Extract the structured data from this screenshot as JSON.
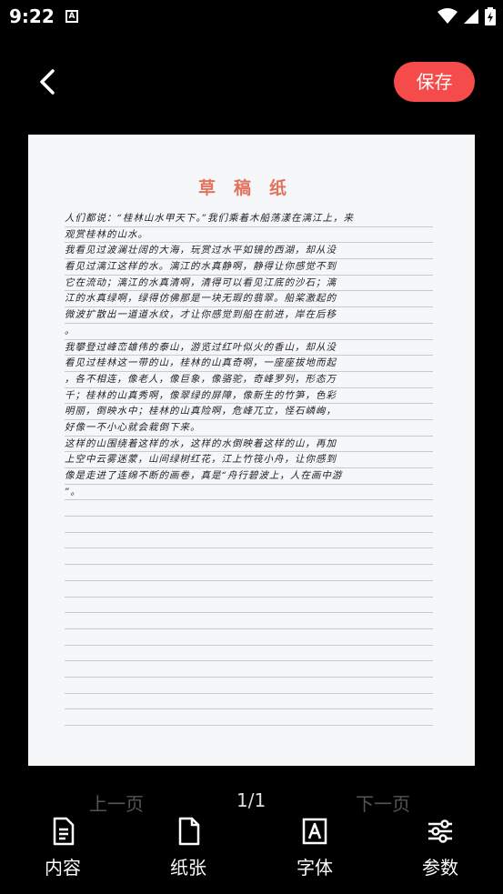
{
  "status": {
    "time": "9:22"
  },
  "toolbar": {
    "save_label": "保存"
  },
  "paper": {
    "title": "草稿纸",
    "lines": [
      "人们都说：“桂林山水甲天下。”我们乘着木船荡漾在漓江上，来",
      "观赏桂林的山水。",
      "我看见过波澜壮阔的大海，玩赏过水平如镜的西湖，却从没",
      "看见过漓江这样的水。漓江的水真静啊，静得让你感觉不到",
      "它在流动；漓江的水真清啊，清得可以看见江底的沙石；漓",
      "江的水真绿啊，绿得仿佛那是一块无瑕的翡翠。船桨激起的",
      "微波扩散出一道道水纹，才让你感觉到船在前进，岸在后移",
      "。",
      "我攀登过峰峦雄伟的泰山，游览过红叶似火的香山，却从没",
      "看见过桂林这一带的山，桂林的山真奇啊，一座座拔地而起",
      "，各不相连，像老人，像巨象，像骆驼，奇峰罗列，形态万",
      "千；桂林的山真秀啊，像翠绿的屏障，像新生的竹笋，色彩",
      "明丽，倒映水中；桂林的山真险啊，危峰兀立，怪石嶙峋，",
      "好像一不小心就会栽倒下来。",
      "这样的山围绕着这样的水，这样的水倒映着这样的山，再加",
      "上空中云雾迷蒙，山间绿树红花，江上竹筏小舟，让你感到",
      "像是走进了连绵不断的画卷，真是“舟行碧波上，人在画中游",
      "”。",
      "",
      "",
      "",
      "",
      "",
      "",
      "",
      "",
      "",
      "",
      "",
      "",
      "",
      ""
    ]
  },
  "pager": {
    "prev_label": "上一页",
    "page_indicator": "1/1",
    "next_label": "下一页"
  },
  "tabs": [
    {
      "label": "内容",
      "icon": "document-icon"
    },
    {
      "label": "纸张",
      "icon": "page-icon"
    },
    {
      "label": "字体",
      "icon": "font-icon"
    },
    {
      "label": "参数",
      "icon": "sliders-icon"
    }
  ],
  "colors": {
    "accent": "#f64b4b",
    "paper": "#f6f7f9",
    "title": "#e3735f"
  }
}
